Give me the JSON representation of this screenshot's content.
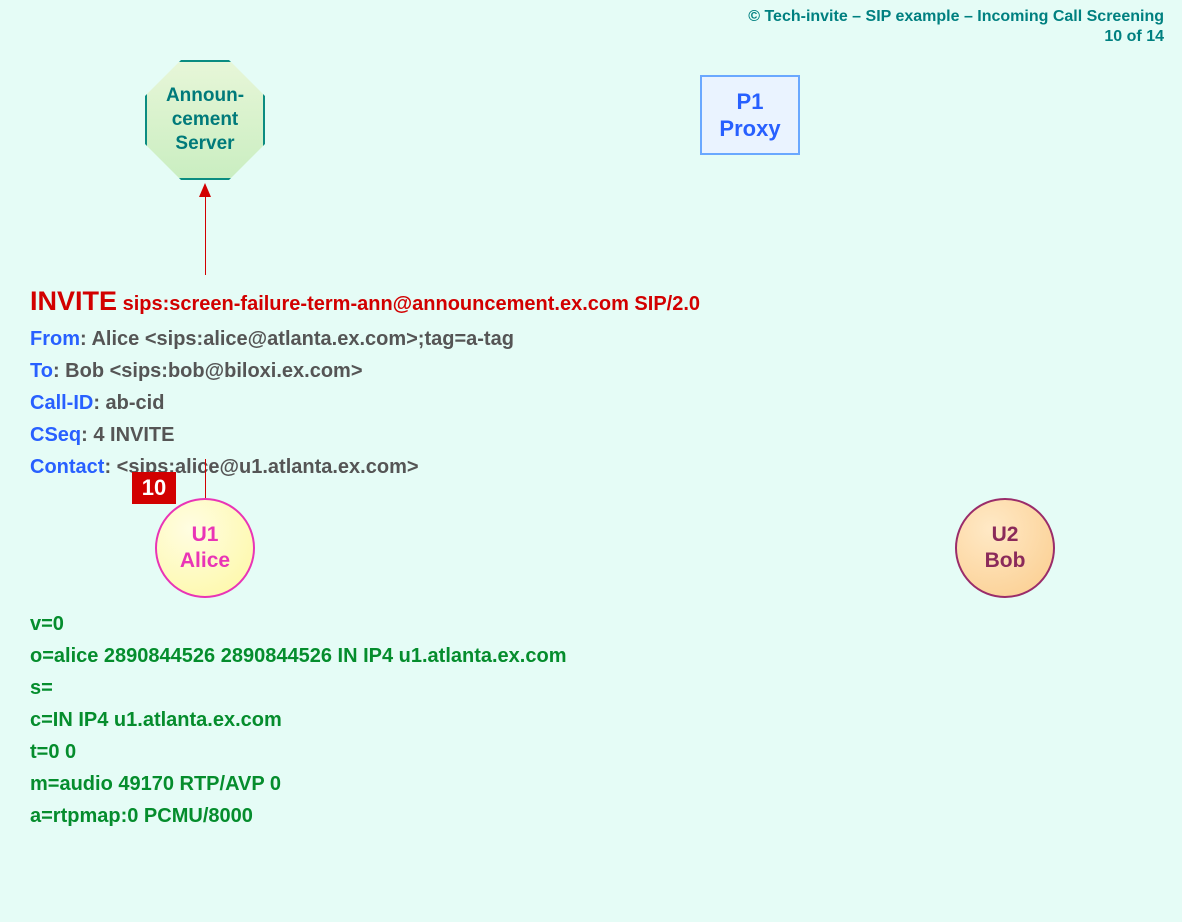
{
  "header": {
    "title": "© Tech-invite – SIP example – Incoming Call Screening",
    "page": "10 of 14"
  },
  "nodes": {
    "announcementServer": {
      "line1": "Announ-",
      "line2": "cement",
      "line3": "Server"
    },
    "proxy": {
      "line1": "P1",
      "line2": "Proxy"
    },
    "u1": {
      "line1": "U1",
      "line2": "Alice"
    },
    "u2": {
      "line1": "U2",
      "line2": "Bob"
    }
  },
  "step": {
    "number": "10"
  },
  "sip": {
    "method": "INVITE",
    "requestUri": "sips:screen-failure-term-ann@announcement.ex.com SIP/2.0",
    "headers": {
      "fromName": "From",
      "fromVal": ": Alice <sips:alice@atlanta.ex.com>;tag=a-tag",
      "toName": "To",
      "toVal": ": Bob <sips:bob@biloxi.ex.com>",
      "callIdName": "Call-ID",
      "callIdVal": ": ab-cid",
      "cseqName": "CSeq",
      "cseqVal": ": 4 INVITE",
      "contactName": "Contact",
      "contactVal": ": <sips:alice@u1.atlanta.ex.com>"
    }
  },
  "sdp": {
    "l1": "v=0",
    "l2": "o=alice  2890844526  2890844526  IN  IP4  u1.atlanta.ex.com",
    "l3": "s=",
    "l4": "c=IN  IP4  u1.atlanta.ex.com",
    "l5": "t=0  0",
    "l6": "m=audio  49170  RTP/AVP  0",
    "l7": "a=rtpmap:0  PCMU/8000"
  }
}
